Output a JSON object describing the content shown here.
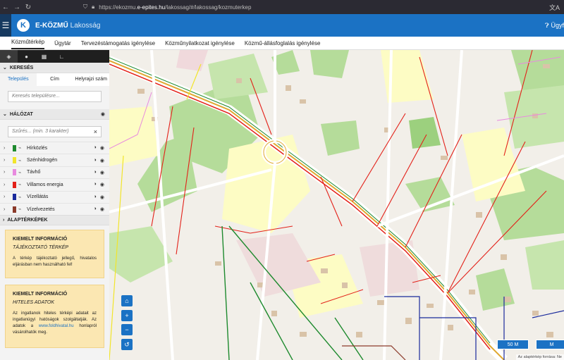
{
  "browser": {
    "url_prefix": "https://ekozmu.",
    "url_domain": "e-epites.hu",
    "url_path": "/lakossag/#/lakossag/kozmuterkep"
  },
  "app": {
    "brand": "E-KÖZMŰ",
    "subtitle": "Lakosság",
    "help_label": "Ügyf",
    "logo_letter": "K"
  },
  "tabs": [
    {
      "label": "Közműtérkép",
      "active": true
    },
    {
      "label": "Ügytár"
    },
    {
      "label": "Tervezéstámogatás igénylése"
    },
    {
      "label": "Közműnyilatkozat igénylése"
    },
    {
      "label": "Közmű-állásfoglalás igénylése"
    }
  ],
  "search": {
    "title": "KERESÉS",
    "tabs": [
      "Település",
      "Cím",
      "Helyrajzi szám"
    ],
    "placeholder": "Keresés településre..."
  },
  "network": {
    "title": "HÁLÓZAT",
    "filter_placeholder": "Szűrés... (min. 3 karakter)",
    "layers": [
      {
        "label": "Hírközlés",
        "color": "#1e8a2e"
      },
      {
        "label": "Szénhidrogén",
        "color": "#f2e52a"
      },
      {
        "label": "Távhő",
        "color": "#e88adf"
      },
      {
        "label": "Villamos energia",
        "color": "#e32119"
      },
      {
        "label": "Vízellátás",
        "color": "#1a2a9c"
      },
      {
        "label": "Vízelvezetés",
        "color": "#8b3a2a"
      }
    ]
  },
  "basemaps": {
    "title": "ALAPTÉRKÉPEK"
  },
  "info1": {
    "heading": "KIEMELT INFORMÁCIÓ",
    "subheading": "TÁJÉKOZTATÓ TÉRKÉP",
    "text": "A térkép tájékoztató jellegű, hivatalos eljárásban nem használható fel!"
  },
  "info2": {
    "heading": "KIEMELT INFORMÁCIÓ",
    "subheading": "HITELES ADATOK",
    "text_before": "Az ingatlanok hiteles térképi adatait az ingatlanügyi hatóságok szolgáltatják. Az adatok a",
    "link": "www.foldhivatal.hu",
    "text_after": "honlapról vásárolhatók meg."
  },
  "map": {
    "scale1": "50 M",
    "scale2": "M",
    "attribution": "Az alaptérkép forrása: Ne"
  }
}
